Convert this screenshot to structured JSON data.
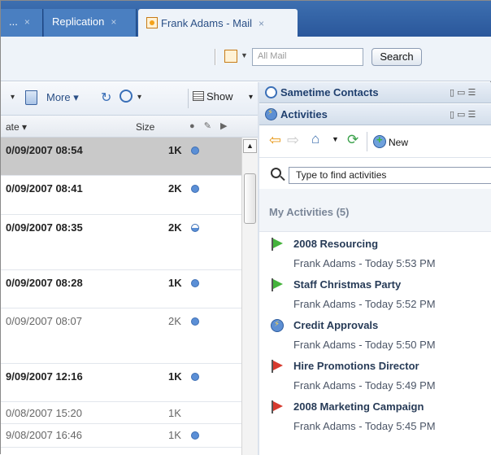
{
  "tabs": [
    {
      "label": "...",
      "close": "×"
    },
    {
      "label": "Replication",
      "close": "×"
    },
    {
      "label": "Frank Adams - Mail",
      "close": "×",
      "active": true
    }
  ],
  "actionbar": {
    "search_placeholder": "All Mail",
    "search_button": "Search"
  },
  "mail_toolbar": {
    "more_label": "More",
    "show_label": "Show"
  },
  "columns": {
    "date": "ate ▾",
    "size": "Size",
    "icons": "● ✎ ▶"
  },
  "messages": [
    {
      "date": "0/09/2007 08:54",
      "size": "1K",
      "state": "unread",
      "selected": true
    },
    {
      "date": "0/09/2007 08:41",
      "size": "2K",
      "state": "unread"
    },
    {
      "date": "0/09/2007 08:35",
      "size": "2K",
      "state": "half"
    },
    {
      "date": "0/09/2007 08:28",
      "size": "1K",
      "state": "unread"
    },
    {
      "date": "0/09/2007 08:07",
      "size": "2K",
      "state": "read"
    },
    {
      "date": "9/09/2007 12:16",
      "size": "1K",
      "state": "unread"
    },
    {
      "date": "0/08/2007 15:20",
      "size": "1K",
      "state": "read-nodot"
    },
    {
      "date": "9/08/2007 16:46",
      "size": "1K",
      "state": "read"
    }
  ],
  "sametime": {
    "title": "Sametime Contacts"
  },
  "activities": {
    "title": "Activities",
    "new_label": "New",
    "find_placeholder": "Type to find activities",
    "section_label": "My Activities (5)",
    "items": [
      {
        "name": "2008 Resourcing",
        "meta": "Frank Adams - Today 5:53 PM",
        "icon": "green-flag-icon"
      },
      {
        "name": "Staff Christmas Party",
        "meta": "Frank Adams - Today 5:52 PM",
        "icon": "green-flag-icon"
      },
      {
        "name": "Credit Approvals",
        "meta": "Frank Adams - Today 5:50 PM",
        "icon": "activity-icon"
      },
      {
        "name": "Hire Promotions Director",
        "meta": "Frank Adams - Today 5:49 PM",
        "icon": "red-flag-icon"
      },
      {
        "name": "2008 Marketing Campaign",
        "meta": "Frank Adams - Today 5:45 PM",
        "icon": "red-flag-icon"
      }
    ]
  }
}
